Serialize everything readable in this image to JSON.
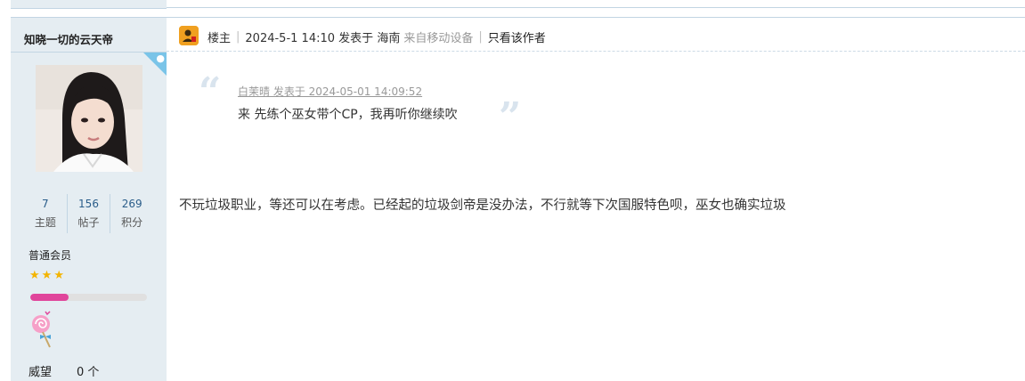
{
  "author": {
    "name": "知晓一切的云天帝",
    "stats": [
      {
        "value": "7",
        "label": "主题"
      },
      {
        "value": "156",
        "label": "帖子"
      },
      {
        "value": "269",
        "label": "积分"
      }
    ],
    "rank": "普通会员",
    "star_count": 3,
    "level_progress": 0.33,
    "prestige_label": "威望",
    "prestige_value": "0 个"
  },
  "post": {
    "floor_label": "楼主",
    "datetime": "2024-5-1 14:10",
    "posted_at_prefix": "发表于",
    "location": "海南",
    "device": "来自移动设备",
    "only_author": "只看该作者",
    "quote": {
      "cite": "白茉晴 发表于 2024-05-01 14:09:52",
      "text": "来 先练个巫女带个CP，我再听你继续吹"
    },
    "body": "不玩垃圾职业，等还可以在考虑。已经起的垃圾剑帝是没办法，不行就等下次国服特色呗，巫女也确实垃圾"
  },
  "colors": {
    "sidebar_bg": "#e5edf2",
    "border": "#c2d5e3",
    "link_blue": "#2a5d8a",
    "progress_pink": "#e0459b",
    "star_gold": "#f3b400"
  },
  "icons": {
    "floor": "user-badge-icon",
    "star": "star-icon",
    "medal": "lollipop-medal-icon",
    "quote_open": "open-quote-icon",
    "quote_close": "close-quote-icon"
  }
}
